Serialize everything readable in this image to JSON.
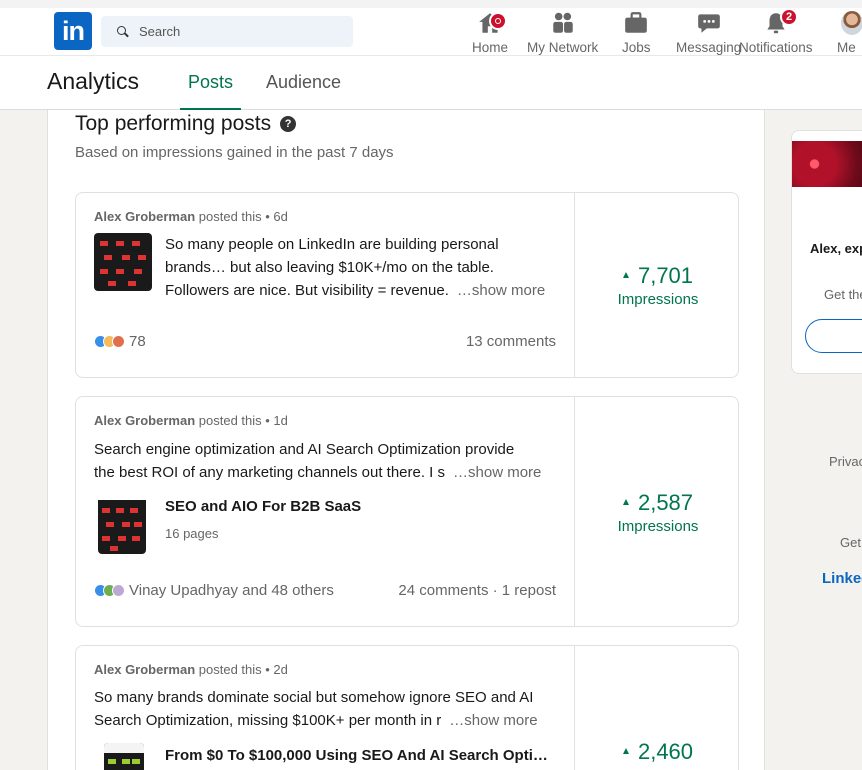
{
  "nav": {
    "logo_text": "in",
    "search_placeholder": "Search",
    "items": [
      {
        "label": "Home"
      },
      {
        "label": "My Network"
      },
      {
        "label": "Jobs"
      },
      {
        "label": "Messaging"
      },
      {
        "label": "Notifications",
        "badge": "2"
      },
      {
        "label": "Me"
      }
    ]
  },
  "subheader": {
    "title": "Analytics",
    "tabs": [
      {
        "label": "Posts",
        "active": true
      },
      {
        "label": "Audience",
        "active": false
      }
    ]
  },
  "section": {
    "title": "Top performing posts",
    "subtitle": "Based on impressions gained in the past 7 days"
  },
  "posts": [
    {
      "author": "Alex Groberman",
      "posted": " posted this • 6d",
      "lines": [
        "So many people on LinkedIn are building personal",
        "brands… but also leaving $10K+/mo on the table.",
        "Followers are nice. But visibility = revenue."
      ],
      "show_more": "…show more",
      "reactions": "78",
      "comments": "13 comments",
      "impressions": "7,701",
      "impressions_label": "Impressions"
    },
    {
      "author": "Alex Groberman",
      "posted": " posted this • 1d",
      "lines": [
        "Search engine optimization and AI Search Optimization provide",
        "the best ROI of any marketing channels out there. I s"
      ],
      "show_more": "…show more",
      "doc_title": "SEO and AIO For B2B SaaS",
      "doc_pages": "16 pages",
      "reactions": "Vinay Upadhyay and 48 others",
      "comments": "24 comments · 1 repost",
      "impressions": "2,587",
      "impressions_label": "Impressions"
    },
    {
      "author": "Alex Groberman",
      "posted": " posted this • 2d",
      "lines": [
        "So many brands dominate social but somehow ignore SEO and AI",
        "Search Optimization, missing $100K+ per month in r"
      ],
      "show_more": "…show more",
      "doc_title": "From $0 To $100,000 Using SEO And AI Search Opti…",
      "impressions": "2,460"
    }
  ],
  "rail": {
    "text1": "Alex, exp",
    "text2": "Get the",
    "footer_privacy": "Privac",
    "footer_get": "Get",
    "footer_logo": "Linked"
  },
  "colors": {
    "brand": "#0a66c2",
    "accent_green": "#01754f",
    "badge_red": "#cb112d"
  }
}
